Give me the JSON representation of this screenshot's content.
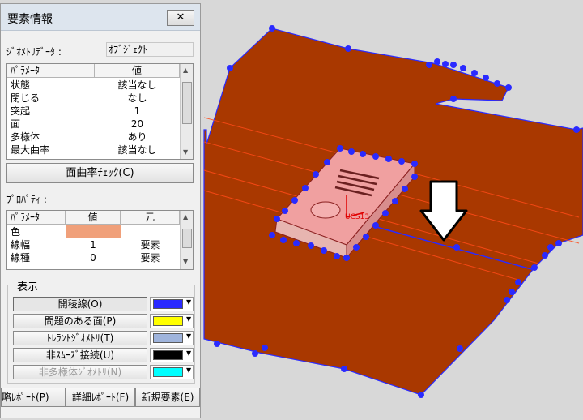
{
  "panel": {
    "title": "要素情報",
    "close_glyph": "✕",
    "geometry_label": "ｼﾞｵﾒﾄﾘﾃﾞｰﾀ :",
    "geometry_value": "ｵﾌﾞｼﾞｪｸﾄ",
    "params_table": {
      "headers": [
        "ﾊﾟﾗﾒｰﾀ",
        "値"
      ],
      "rows": [
        [
          "状態",
          "該当なし"
        ],
        [
          "閉じる",
          "なし"
        ],
        [
          "突起",
          "1"
        ],
        [
          "面",
          "20"
        ],
        [
          "多様体",
          "あり"
        ],
        [
          "最大曲率",
          "該当なし"
        ]
      ]
    },
    "curvature_check_button": "面曲率ﾁｪｯｸ(C)",
    "property_label": "ﾌﾟﾛﾊﾟﾃｨ :",
    "prop_table": {
      "headers": [
        "ﾊﾟﾗﾒｰﾀ",
        "値",
        "元"
      ],
      "rows": [
        {
          "param": "色",
          "value": "",
          "source": "",
          "color": "#f0a07a"
        },
        {
          "param": "線幅",
          "value": "1",
          "source": "要素"
        },
        {
          "param": "線種",
          "value": "0",
          "source": "要素"
        }
      ]
    },
    "display_group": {
      "legend": "表示",
      "items": [
        {
          "label": "開稜線(O)",
          "color": "#2a2aff"
        },
        {
          "label": "問題のある面(P)",
          "color": "#ffff00"
        },
        {
          "label": "ﾄﾚﾗﾝﾄｼﾞｵﾒﾄﾘ(T)",
          "color": "#9fb4dc"
        },
        {
          "label": "非ｽﾑｰｽﾞ接続(U)",
          "color": "#000000"
        },
        {
          "label": "非多様体ｼﾞｵﾒﾄﾘ(N)",
          "color": "#00ffff"
        }
      ]
    },
    "bottom_buttons": [
      "略ﾚﾎﾟｰﾄ(P)",
      "詳細ﾚﾎﾟｰﾄ(F)",
      "新規要素(E)"
    ]
  },
  "viewport": {
    "axis_label": "UCS13",
    "colors": {
      "background": "#d8d8d8",
      "plate": "#a93800",
      "part_body": "#f0a0a0",
      "edge": "#2a2aff",
      "arrow_fill": "#ffffff"
    }
  }
}
